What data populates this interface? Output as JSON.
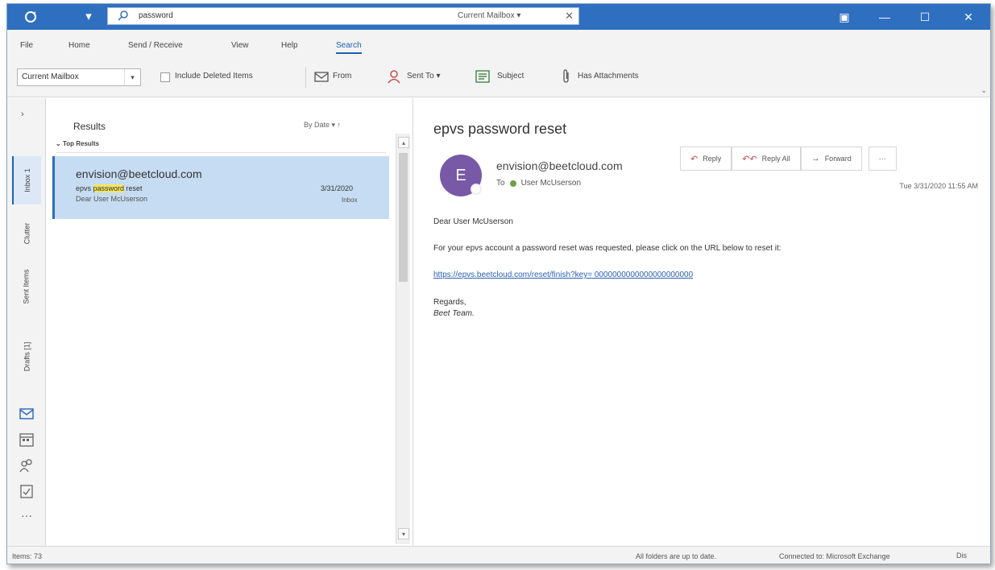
{
  "titlebar": {
    "search_value": "password",
    "search_scope": "Current Mailbox ▾",
    "clear_icon": "close-icon"
  },
  "menu": {
    "tabs": [
      "File",
      "Home",
      "Send / Receive",
      "View",
      "Help",
      "Search"
    ],
    "active_tab": "Search"
  },
  "ribbon": {
    "scope_select": "Current Mailbox",
    "include_deleted": "Include Deleted Items",
    "from": "From",
    "sent_to": "Sent To ▾",
    "subject": "Subject",
    "has_attachments": "Has Attachments"
  },
  "folders": {
    "items": [
      "Inbox 1",
      "Clutter",
      "Sent Items",
      "Drafts [1]"
    ],
    "active_index": 0
  },
  "list": {
    "title": "Results",
    "sort": "By Date ▾  ↑",
    "group": "Top Results",
    "messages": [
      {
        "from": "envision@beetcloud.com",
        "subject_prefix": "epvs ",
        "subject_highlight": "password",
        "subject_suffix": " reset",
        "date": "3/31/2020",
        "preview": "Dear User McUserson",
        "folder": "Inbox"
      }
    ]
  },
  "reading": {
    "subject": "epvs password reset",
    "avatar_initial": "E",
    "from": "envision@beetcloud.com",
    "to_label": "To",
    "to": "User McUserson",
    "reply": "Reply",
    "reply_all": "Reply All",
    "forward": "Forward",
    "more": "···",
    "date": "Tue 3/31/2020 11:55 AM",
    "greeting": "Dear User McUserson",
    "body": "For your epvs account a password reset was requested, please click on the URL below to reset it:",
    "link": "https://epvs.beetcloud.com/reset/finish?key= 0000000000000000000000",
    "sign_1": "Regards,",
    "sign_2": "Beet Team."
  },
  "status": {
    "items": "Items: 73",
    "folders": "All folders are up to date.",
    "connection": "Connected to: Microsoft Exchange",
    "display": "Dis"
  },
  "colors": {
    "title_bar": "#2f6fbf",
    "selected_item": "#c6dcf2",
    "avatar": "#7759a7",
    "highlight": "#f5e663"
  }
}
